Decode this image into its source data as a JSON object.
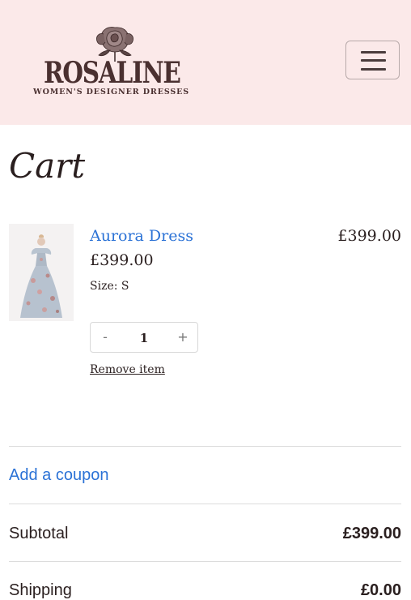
{
  "header": {
    "logo_name": "ROSALINE",
    "logo_tagline": "WOMEN'S DESIGNER DRESSES",
    "menu_icon": "hamburger-menu-icon",
    "background_color": "#fbe9e9"
  },
  "page": {
    "title": "Cart"
  },
  "cart": {
    "items": [
      {
        "name": "Aurora Dress",
        "price": "£399.00",
        "size": "Size: S",
        "quantity": "1",
        "decrement_label": "-",
        "increment_label": "+",
        "line_total": "£399.00",
        "remove_label": "Remove item"
      }
    ]
  },
  "coupon": {
    "label": "Add a coupon"
  },
  "totals": {
    "subtotal_label": "Subtotal",
    "subtotal_value": "£399.00",
    "shipping_label": "Shipping",
    "shipping_value": "£0.00"
  },
  "colors": {
    "link": "#2b72d6",
    "text": "#2a1f1f"
  }
}
